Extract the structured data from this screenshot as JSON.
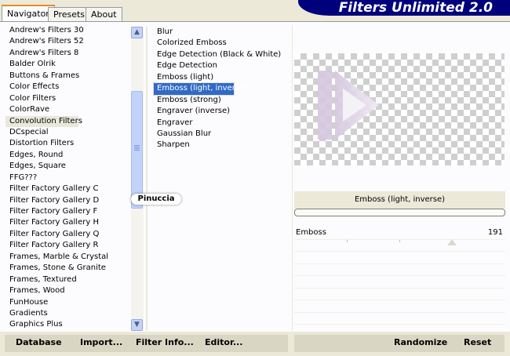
{
  "tabs": [
    "Navigator",
    "Presets",
    "About"
  ],
  "app_title": "Filters Unlimited 2.0",
  "categories": [
    "Andrew's Filters 30",
    "Andrew's Filters 52",
    "Andrew's Filters 8",
    "Balder Olrik",
    "Buttons & Frames",
    "Color Effects",
    "Color Filters",
    "ColorRave",
    "Convolution Filters",
    "DCspecial",
    "Distortion Filters",
    "Edges, Round",
    "Edges, Square",
    "FFG???",
    "Filter Factory Gallery C",
    "Filter Factory Gallery D",
    "Filter Factory Gallery F",
    "Filter Factory Gallery H",
    "Filter Factory Gallery Q",
    "Filter Factory Gallery R",
    "Frames, Marble & Crystal",
    "Frames, Stone & Granite",
    "Frames, Textured",
    "Frames, Wood",
    "FunHouse",
    "Gradients",
    "Graphics Plus"
  ],
  "selected_category": "Convolution Filters",
  "filters": [
    "Blur",
    "Colorized Emboss",
    "Edge Detection (Black & White)",
    "Edge Detection",
    "Emboss (light)",
    "Emboss (light, inverse)",
    "Emboss (strong)",
    "Engraver (inverse)",
    "Engraver",
    "Gaussian Blur",
    "Sharpen"
  ],
  "selected_filter": "Emboss (light, inverse)",
  "watermark": "Pinuccia",
  "filter_name": "Emboss (light, inverse)",
  "param": {
    "label": "Emboss",
    "value": "191",
    "level_fraction": 0.749
  },
  "buttons": {
    "database": "Database",
    "import": "Import...",
    "filter_info": "Filter Info...",
    "editor": "Editor...",
    "randomize": "Randomize",
    "reset": "Reset"
  },
  "colors": {
    "title_bar": "#00007c",
    "selection": "#316ac5",
    "tab_accent": "#e68b2c"
  }
}
